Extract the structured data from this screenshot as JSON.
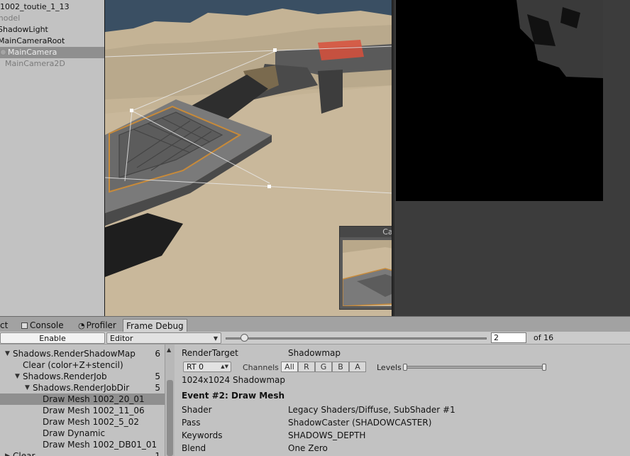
{
  "hierarchy": {
    "items": [
      {
        "label": "1002_toutie_1_13",
        "state": "normal"
      },
      {
        "label": "model",
        "state": "dim"
      },
      {
        "label": "ShadowLight",
        "state": "normal"
      },
      {
        "label": "MainCameraRoot",
        "state": "normal"
      },
      {
        "label": "MainCamera",
        "state": "selected"
      },
      {
        "label": "MainCamera2D",
        "state": "dim"
      }
    ]
  },
  "scene": {
    "preview_title": "Camera Preview"
  },
  "tabs": [
    {
      "label": "ct",
      "active": false
    },
    {
      "label": "Console",
      "active": false
    },
    {
      "label": "Profiler",
      "active": false
    },
    {
      "label": "Frame Debug",
      "active": true
    }
  ],
  "toolbar": {
    "enable_label": "Enable",
    "target_select": "Editor",
    "event_index": "2",
    "event_total": "of 16",
    "slider_position": 0.07
  },
  "tree": {
    "rows": [
      {
        "label": "Shadows.RenderShadowMap",
        "count": "6",
        "level": 0,
        "arrow": "down",
        "selected": false
      },
      {
        "label": "Clear (color+Z+stencil)",
        "count": "",
        "level": 1,
        "arrow": "",
        "selected": false
      },
      {
        "label": "Shadows.RenderJob",
        "count": "5",
        "level": 1,
        "arrow": "down",
        "selected": false
      },
      {
        "label": "Shadows.RenderJobDir",
        "count": "5",
        "level": 2,
        "arrow": "down",
        "selected": false
      },
      {
        "label": "Draw Mesh 1002_20_01",
        "count": "",
        "level": 3,
        "arrow": "",
        "selected": true
      },
      {
        "label": "Draw Mesh 1002_11_06",
        "count": "",
        "level": 3,
        "arrow": "",
        "selected": false
      },
      {
        "label": "Draw Mesh 1002_5_02",
        "count": "",
        "level": 3,
        "arrow": "",
        "selected": false
      },
      {
        "label": "Draw Dynamic",
        "count": "",
        "level": 3,
        "arrow": "",
        "selected": false
      },
      {
        "label": "Draw Mesh 1002_DB01_01",
        "count": "",
        "level": 3,
        "arrow": "",
        "selected": false
      },
      {
        "label": "Clear",
        "count": "1",
        "level": 0,
        "arrow": "right",
        "selected": false
      }
    ]
  },
  "details": {
    "render_target_label": "RenderTarget",
    "render_target_value": "Shadowmap",
    "rt_select": "RT 0",
    "channels_label": "Channels",
    "channels": [
      "All",
      "R",
      "G",
      "B",
      "A"
    ],
    "levels_label": "Levels",
    "levels_range": [
      0,
      1
    ],
    "resolution": "1024x1024 Shadowmap",
    "event_title": "Event #2: Draw Mesh",
    "props": [
      {
        "key": "Shader",
        "value": "Legacy Shaders/Diffuse, SubShader #1"
      },
      {
        "key": "Pass",
        "value": "ShadowCaster (SHADOWCASTER)"
      },
      {
        "key": "Keywords",
        "value": "SHADOWS_DEPTH"
      },
      {
        "key": "Blend",
        "value": "One Zero"
      }
    ]
  }
}
